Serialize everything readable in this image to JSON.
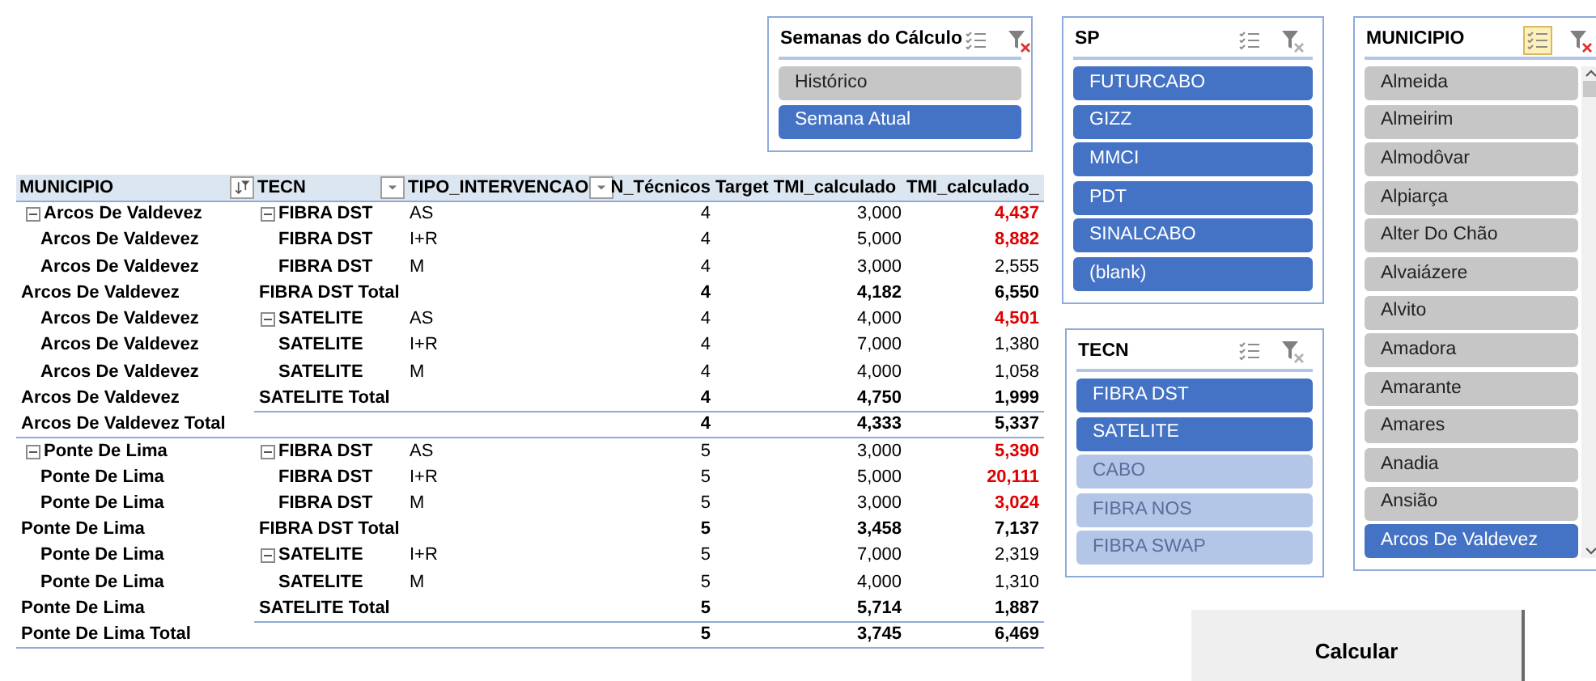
{
  "semanas_slicer": {
    "title": "Semanas do Cálculo",
    "multi_select": false,
    "filtered": true,
    "items": [
      {
        "label": "Histórico",
        "selected": false,
        "has_data": true
      },
      {
        "label": "Semana Atual",
        "selected": true,
        "has_data": true
      }
    ]
  },
  "pivot_table": {
    "columns": [
      {
        "label": "MUNICIPIO",
        "has_dropdown": true,
        "filter_applied": true
      },
      {
        "label": "TECN",
        "has_dropdown": true,
        "filter_applied": false
      },
      {
        "label": "TIPO_INTERVENCAO",
        "has_dropdown": true,
        "filter_applied": false
      },
      {
        "label": "N_Técnicos",
        "has_dropdown": false
      },
      {
        "label": "Target TMI_calculado",
        "has_dropdown": false
      },
      {
        "label": "TMI_calculado_",
        "has_dropdown": false
      }
    ],
    "rows": [
      {
        "kind": "detail",
        "municipio": "Arcos De Valdevez",
        "municipio_expander": true,
        "tecn": "FIBRA DST",
        "tecn_expander": true,
        "tipo": "AS",
        "n_tecnicos": "4",
        "target": "3,000",
        "tmi": "4,437",
        "tmi_alert": true
      },
      {
        "kind": "detail",
        "municipio": "Arcos De Valdevez",
        "municipio_expander": false,
        "tecn": "FIBRA DST",
        "tecn_expander": false,
        "tipo": "I+R",
        "n_tecnicos": "4",
        "target": "5,000",
        "tmi": "8,882",
        "tmi_alert": true
      },
      {
        "kind": "detail",
        "municipio": "Arcos De Valdevez",
        "municipio_expander": false,
        "tecn": "FIBRA DST",
        "tecn_expander": false,
        "tipo": "M",
        "n_tecnicos": "4",
        "target": "3,000",
        "tmi": "2,555",
        "tmi_alert": false
      },
      {
        "kind": "subtotal",
        "municipio": "Arcos De Valdevez",
        "tecn": "FIBRA DST Total",
        "n_tecnicos": "4",
        "target": "4,182",
        "tmi": "6,550",
        "tmi_alert": false
      },
      {
        "kind": "detail",
        "municipio": "Arcos De Valdevez",
        "municipio_expander": false,
        "tecn": "SATELITE",
        "tecn_expander": true,
        "tipo": "AS",
        "n_tecnicos": "4",
        "target": "4,000",
        "tmi": "4,501",
        "tmi_alert": true
      },
      {
        "kind": "detail",
        "municipio": "Arcos De Valdevez",
        "municipio_expander": false,
        "tecn": "SATELITE",
        "tecn_expander": false,
        "tipo": "I+R",
        "n_tecnicos": "4",
        "target": "7,000",
        "tmi": "1,380",
        "tmi_alert": false
      },
      {
        "kind": "detail",
        "municipio": "Arcos De Valdevez",
        "municipio_expander": false,
        "tecn": "SATELITE",
        "tecn_expander": false,
        "tipo": "M",
        "n_tecnicos": "4",
        "target": "4,000",
        "tmi": "1,058",
        "tmi_alert": false
      },
      {
        "kind": "subtotal",
        "municipio": "Arcos De Valdevez",
        "tecn": "SATELITE Total",
        "n_tecnicos": "4",
        "target": "4,750",
        "tmi": "1,999",
        "tmi_alert": false
      },
      {
        "kind": "total",
        "municipio": "Arcos De Valdevez Total",
        "n_tecnicos": "4",
        "target": "4,333",
        "tmi": "5,337",
        "tmi_alert": false
      },
      {
        "kind": "detail",
        "municipio": "Ponte De Lima",
        "municipio_expander": true,
        "tecn": "FIBRA DST",
        "tecn_expander": true,
        "tipo": "AS",
        "n_tecnicos": "5",
        "target": "3,000",
        "tmi": "5,390",
        "tmi_alert": true
      },
      {
        "kind": "detail",
        "municipio": "Ponte De Lima",
        "municipio_expander": false,
        "tecn": "FIBRA DST",
        "tecn_expander": false,
        "tipo": "I+R",
        "n_tecnicos": "5",
        "target": "5,000",
        "tmi": "20,111",
        "tmi_alert": true
      },
      {
        "kind": "detail",
        "municipio": "Ponte De Lima",
        "municipio_expander": false,
        "tecn": "FIBRA DST",
        "tecn_expander": false,
        "tipo": "M",
        "n_tecnicos": "5",
        "target": "3,000",
        "tmi": "3,024",
        "tmi_alert": true
      },
      {
        "kind": "subtotal",
        "municipio": "Ponte De Lima",
        "tecn": "FIBRA DST Total",
        "n_tecnicos": "5",
        "target": "3,458",
        "tmi": "7,137",
        "tmi_alert": false
      },
      {
        "kind": "detail",
        "municipio": "Ponte De Lima",
        "municipio_expander": false,
        "tecn": "SATELITE",
        "tecn_expander": true,
        "tipo": "I+R",
        "n_tecnicos": "5",
        "target": "7,000",
        "tmi": "2,319",
        "tmi_alert": false
      },
      {
        "kind": "detail",
        "municipio": "Ponte De Lima",
        "municipio_expander": false,
        "tecn": "SATELITE",
        "tecn_expander": false,
        "tipo": "M",
        "n_tecnicos": "5",
        "target": "4,000",
        "tmi": "1,310",
        "tmi_alert": false
      },
      {
        "kind": "subtotal",
        "municipio": "Ponte De Lima",
        "tecn": "SATELITE Total",
        "n_tecnicos": "5",
        "target": "5,714",
        "tmi": "1,887",
        "tmi_alert": false
      },
      {
        "kind": "total",
        "municipio": "Ponte De Lima Total",
        "n_tecnicos": "5",
        "target": "3,745",
        "tmi": "6,469",
        "tmi_alert": false
      }
    ]
  },
  "sp_slicer": {
    "title": "SP",
    "multi_select": false,
    "filtered": false,
    "items": [
      {
        "label": "FUTURCABO",
        "selected": true,
        "has_data": true
      },
      {
        "label": "GIZZ",
        "selected": true,
        "has_data": true
      },
      {
        "label": "MMCI",
        "selected": true,
        "has_data": true
      },
      {
        "label": "PDT",
        "selected": true,
        "has_data": true
      },
      {
        "label": "SINALCABO",
        "selected": true,
        "has_data": true
      },
      {
        "label": "(blank)",
        "selected": true,
        "has_data": true
      }
    ]
  },
  "tecn_slicer": {
    "title": "TECN",
    "multi_select": false,
    "filtered": false,
    "items": [
      {
        "label": "FIBRA DST",
        "selected": true,
        "has_data": true
      },
      {
        "label": "SATELITE",
        "selected": true,
        "has_data": true
      },
      {
        "label": "CABO",
        "selected": true,
        "has_data": false
      },
      {
        "label": "FIBRA NOS",
        "selected": true,
        "has_data": false
      },
      {
        "label": "FIBRA SWAP",
        "selected": true,
        "has_data": false
      }
    ]
  },
  "municipio_slicer": {
    "title": "MUNICIPIO",
    "multi_select": true,
    "filtered": true,
    "items": [
      {
        "label": "Almeida",
        "selected": false,
        "has_data": true
      },
      {
        "label": "Almeirim",
        "selected": false,
        "has_data": true
      },
      {
        "label": "Almodôvar",
        "selected": false,
        "has_data": true
      },
      {
        "label": "Alpiarça",
        "selected": false,
        "has_data": true
      },
      {
        "label": "Alter Do Chão",
        "selected": false,
        "has_data": true
      },
      {
        "label": "Alvaiázere",
        "selected": false,
        "has_data": true
      },
      {
        "label": "Alvito",
        "selected": false,
        "has_data": true
      },
      {
        "label": "Amadora",
        "selected": false,
        "has_data": true
      },
      {
        "label": "Amarante",
        "selected": false,
        "has_data": true
      },
      {
        "label": "Amares",
        "selected": false,
        "has_data": true
      },
      {
        "label": "Anadia",
        "selected": false,
        "has_data": true
      },
      {
        "label": "Ansião",
        "selected": false,
        "has_data": true
      },
      {
        "label": "Arcos De Valdevez",
        "selected": true,
        "has_data": true
      }
    ]
  },
  "calcular_button": {
    "label": "Calcular"
  }
}
